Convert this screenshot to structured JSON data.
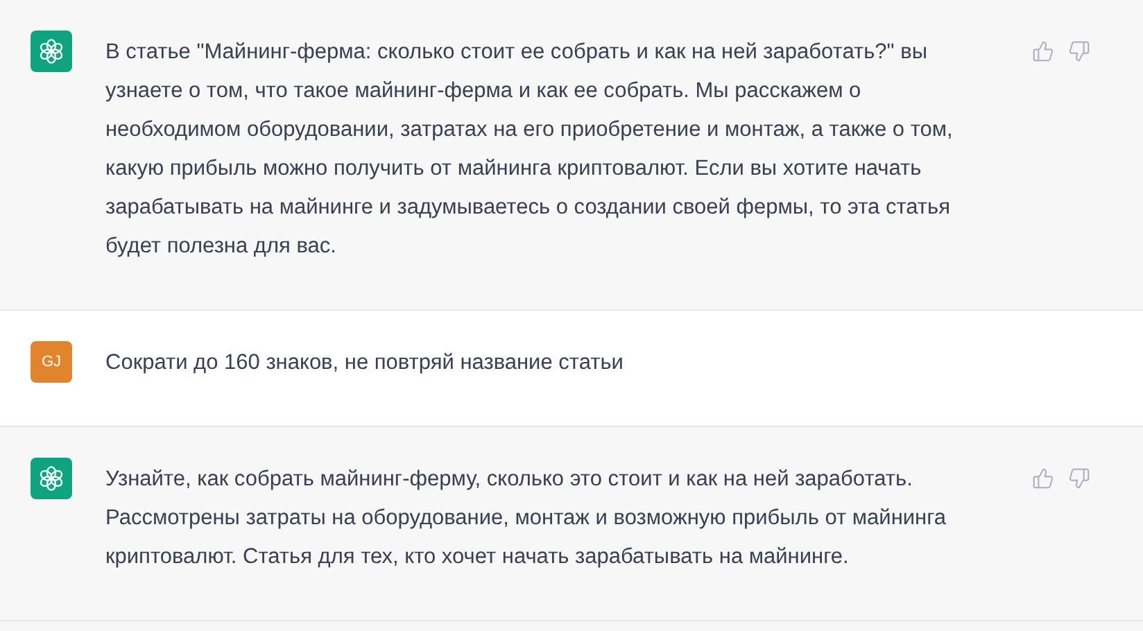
{
  "messages": [
    {
      "kind": "assistant",
      "text": "В статье \"Майнинг-ферма: сколько стоит ее собрать и как на ней заработать?\" вы узнаете о том, что такое майнинг-ферма и как ее собрать. Мы расскажем о необходимом оборудовании, затратах на его приобретение и монтаж, а также о том, какую прибыль можно получить от майнинга криптовалют. Если вы хотите начать зарабатывать на майнинге и задумываетесь о создании своей фермы, то эта статья будет полезна для вас."
    },
    {
      "kind": "user",
      "avatar": "GJ",
      "text": "Сократи до 160 знаков, не повтряй название статьи"
    },
    {
      "kind": "assistant",
      "text": "Узнайте, как собрать майнинг-ферму, сколько это стоит и как на ней заработать. Рассмотрены затраты на оборудование, монтаж и возможную прибыль от майнинга криптовалют. Статья для тех, кто хочет начать зарабатывать на майнинге."
    }
  ]
}
